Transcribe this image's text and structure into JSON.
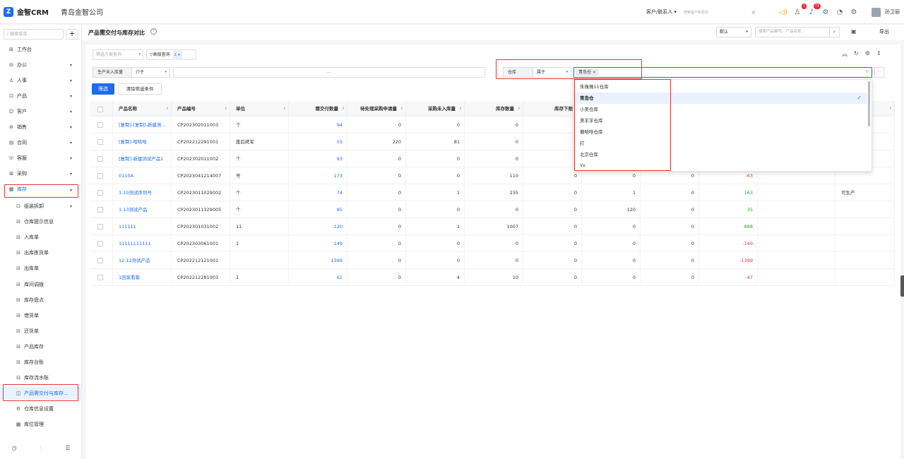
{
  "topbar": {
    "logo_text": "金智CRM",
    "company": "青岛金智公司",
    "customer_select": "客户/联系人 ▾",
    "search_placeholder": "搜索客户和更多",
    "badge_notify": "1",
    "badge_messages": "73",
    "username": "孙卫丽"
  },
  "sidebar": {
    "search_placeholder": "搜索菜单",
    "plus": "+",
    "items": [
      {
        "label": "工作台",
        "icon": "grid-icon",
        "glyph": "⊞"
      },
      {
        "label": "办公",
        "icon": "folder-icon",
        "glyph": "⊟",
        "arrow": "▾"
      },
      {
        "label": "人事",
        "icon": "person-icon",
        "glyph": "♙",
        "arrow": "▾"
      },
      {
        "label": "产品",
        "icon": "box-icon",
        "glyph": "⊡",
        "arrow": "▾"
      },
      {
        "label": "客户",
        "icon": "customer-icon",
        "glyph": "☺",
        "arrow": "▾"
      },
      {
        "label": "销售",
        "icon": "sales-icon",
        "glyph": "⊛",
        "arrow": "▾"
      },
      {
        "label": "合同",
        "icon": "contract-icon",
        "glyph": "▤",
        "arrow": "▾"
      },
      {
        "label": "客服",
        "icon": "service-icon",
        "glyph": "☏",
        "arrow": "▾"
      },
      {
        "label": "采购",
        "icon": "purchase-icon",
        "glyph": "⊠",
        "arrow": "▾"
      },
      {
        "label": "库存",
        "icon": "stock-icon",
        "glyph": "▦",
        "arrow": "▴"
      }
    ],
    "sub_items": [
      {
        "label": "组装拆卸",
        "icon": "assemble-icon",
        "glyph": "⊡",
        "arrow": "▾"
      },
      {
        "label": "仓库提示信息",
        "icon": "hint-icon",
        "glyph": "⊟"
      },
      {
        "label": "入库单",
        "icon": "inbound-icon",
        "glyph": "⊟"
      },
      {
        "label": "出库拣货单",
        "icon": "picking-icon",
        "glyph": "⊟"
      },
      {
        "label": "出库单",
        "icon": "outbound-icon",
        "glyph": "⊟"
      },
      {
        "label": "库间调拨",
        "icon": "transfer-icon",
        "glyph": "⊟"
      },
      {
        "label": "库存盘点",
        "icon": "inventory-check-icon",
        "glyph": "⊟"
      },
      {
        "label": "借货单",
        "icon": "borrow-icon",
        "glyph": "⊟"
      },
      {
        "label": "还货单",
        "icon": "return-icon",
        "glyph": "⊟"
      },
      {
        "label": "产品库存",
        "icon": "product-stock-icon",
        "glyph": "⊟"
      },
      {
        "label": "库存台账",
        "icon": "ledger-icon",
        "glyph": "⊟"
      },
      {
        "label": "库存流水账",
        "icon": "flow-icon",
        "glyph": "⊟"
      },
      {
        "label": "产品需交付与库存...",
        "icon": "compare-icon",
        "glyph": "◫"
      },
      {
        "label": "仓库信息设置",
        "icon": "settings-icon",
        "glyph": "⚙"
      },
      {
        "label": "库位管理",
        "icon": "location-icon",
        "glyph": "▦"
      }
    ]
  },
  "header": {
    "title": "产品需交付与库存对比",
    "help": "?",
    "view": "默认",
    "product_search_placeholder": "搜索产品编号、产品名称...",
    "export": "导出"
  },
  "filter": {
    "scheme_placeholder": "筛选方案查询",
    "advanced_query": "高级查询",
    "advanced_count": "1 ×",
    "cond1_field": "生产未入库量",
    "cond1_op": "介于",
    "cond1_range_sep": "—",
    "cond2_field": "仓库",
    "cond2_op": "属于",
    "cond2_tag": "青岛仓 ×",
    "more": "···",
    "filter_button": "筛选",
    "clear_button": "清除筛选条件"
  },
  "table": {
    "headers": [
      "产品名称",
      "产品编号",
      "单位",
      "需交付数量",
      "待处理采购申请量",
      "采购未入库量",
      "库存数量",
      "库存下限"
    ],
    "rows": [
      {
        "name": "[复制]-[复制]-新建测...",
        "code": "CP202302011003",
        "unit": "个",
        "deliver": "94",
        "pending": "0",
        "purchase": "0",
        "stock": "0",
        "limit": "",
        "extra1": "",
        "extra2": "",
        "diff": "",
        "status": ""
      },
      {
        "name": "[复制]-哈哈哈",
        "code": "CP202212291001",
        "unit": "废后拷军",
        "deliver": "55",
        "pending": "220",
        "purchase": "81",
        "stock": "0",
        "limit": "",
        "extra1": "",
        "extra2": "",
        "diff": "",
        "status": ""
      },
      {
        "name": "[复制]-新建测试产品1",
        "code": "CP202302011002",
        "unit": "个",
        "deliver": "93",
        "pending": "0",
        "purchase": "0",
        "stock": "0",
        "limit": "",
        "extra1": "",
        "extra2": "",
        "diff": "",
        "status": ""
      },
      {
        "name": "0110A",
        "code": "CP2023041214007",
        "unit": "号",
        "deliver": "173",
        "pending": "0",
        "purchase": "0",
        "stock": "110",
        "limit": "0",
        "extra1": "0",
        "extra2": "0",
        "diff": "-63",
        "status": ""
      },
      {
        "name": "1.10测试序列号",
        "code": "CP202301102900​2",
        "unit": "个",
        "deliver": "74",
        "pending": "0",
        "purchase": "1",
        "stock": "235",
        "limit": "0",
        "extra1": "1",
        "extra2": "0",
        "diff": "163",
        "status": "可生产"
      },
      {
        "name": "1.13测试产品",
        "code": "CP202301132900​5",
        "unit": "个",
        "deliver": "85",
        "pending": "0",
        "purchase": "0",
        "stock": "0",
        "limit": "0",
        "extra1": "120",
        "extra2": "0",
        "diff": "35",
        "status": ""
      },
      {
        "name": "111111",
        "code": "CP202301031002",
        "unit": "11",
        "deliver": "120",
        "pending": "0",
        "purchase": "1",
        "stock": "1007",
        "limit": "0",
        "extra1": "0",
        "extra2": "0",
        "diff": "888",
        "status": ""
      },
      {
        "name": "11111111111",
        "code": "CP202303061001",
        "unit": "1",
        "deliver": "149",
        "pending": "0",
        "purchase": "0",
        "stock": "0",
        "limit": "0",
        "extra1": "0",
        "extra2": "0",
        "diff": "-149",
        "status": ""
      },
      {
        "name": "12.12测试产品",
        "code": "CP202212121001",
        "unit": "",
        "deliver": "1399",
        "pending": "0",
        "purchase": "0",
        "stock": "0",
        "limit": "0",
        "extra1": "0",
        "extra2": "0",
        "diff": "-1399",
        "status": ""
      },
      {
        "name": "1回家看看",
        "code": "CP202212281003",
        "unit": "1",
        "deliver": "61",
        "pending": "0",
        "purchase": "4",
        "stock": "10",
        "limit": "0",
        "extra1": "0",
        "extra2": "0",
        "diff": "-47",
        "status": ""
      }
    ]
  },
  "dropdown": {
    "options": [
      "朱珠珠11仓库",
      "青岛仓",
      "小美仓库",
      "美羊羊仓库",
      "懒哈哈仓库",
      "打",
      "北京仓库",
      "YY"
    ],
    "selected_index": 1,
    "check": "✓"
  },
  "colors": {
    "accent": "#1f6be8",
    "highlight_box": "#e53935",
    "positive": "#2aa52a",
    "negative": "#e53935"
  }
}
